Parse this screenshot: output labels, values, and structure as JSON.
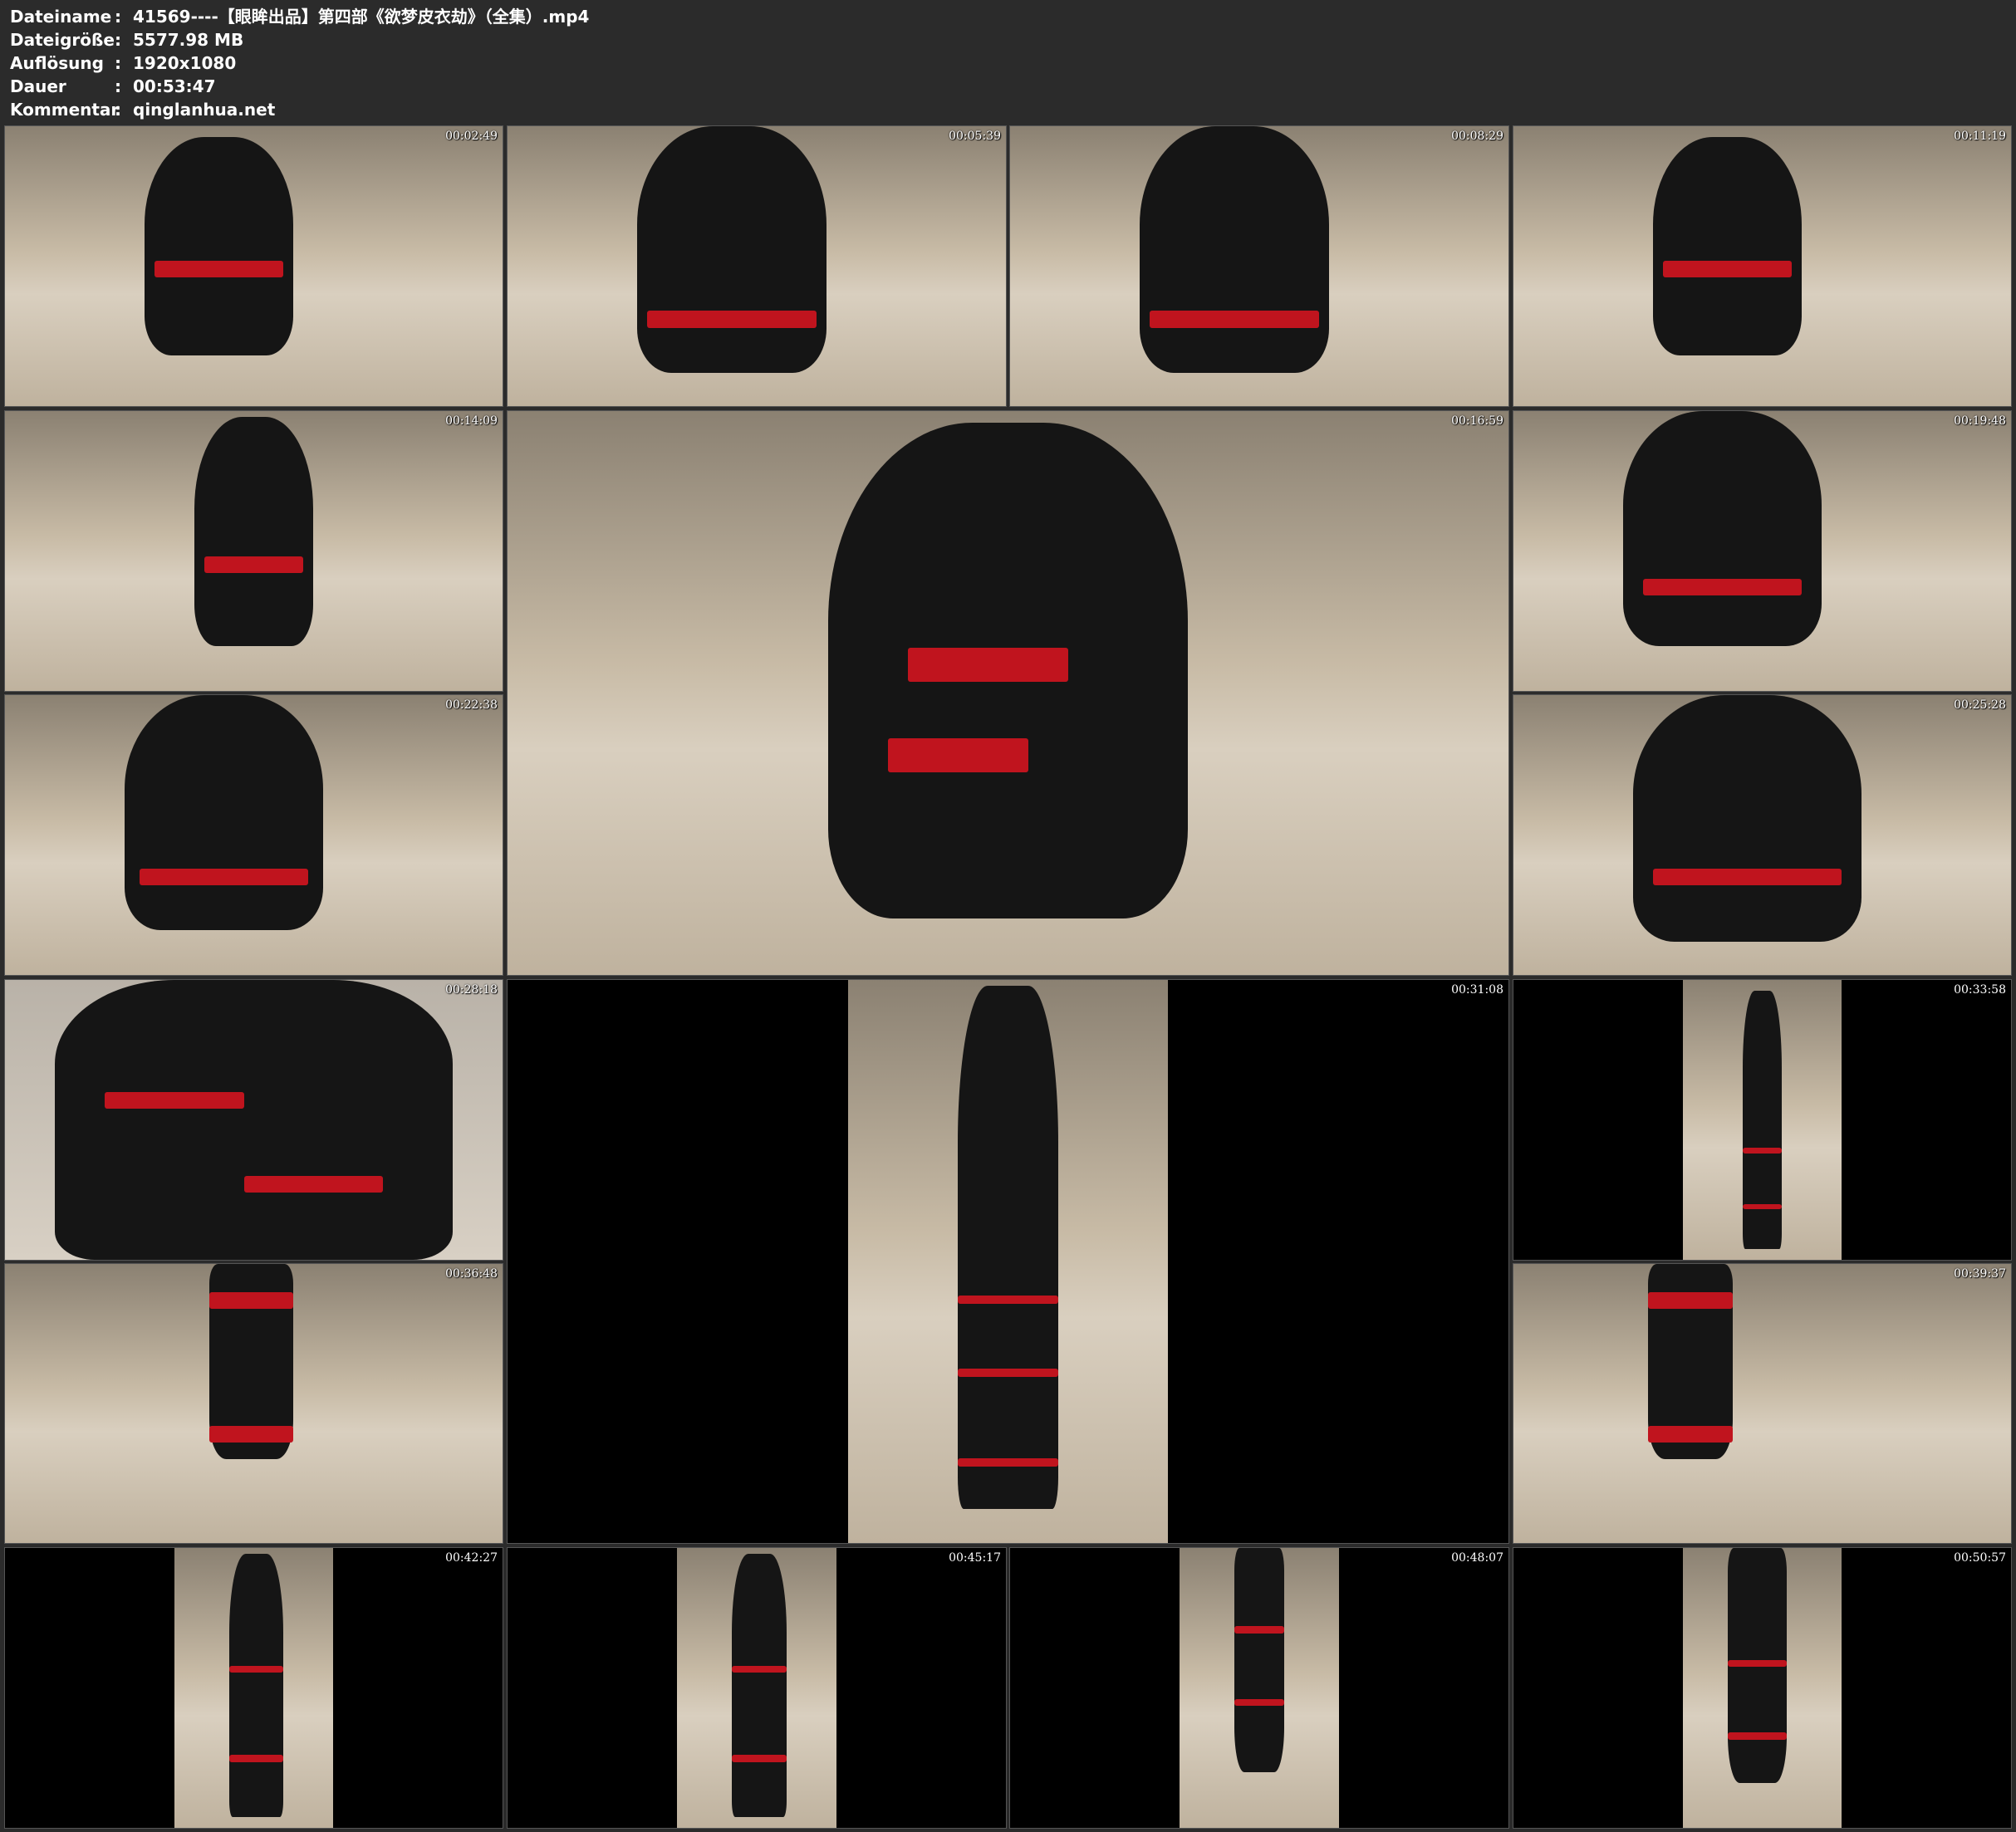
{
  "info": {
    "filename_label": "Dateiname",
    "filename": "41569----【眼眸出品】第四部《欲梦皮衣劫》（全集）.mp4",
    "filesize_label": "Dateigröße",
    "filesize": "5577.98 MB",
    "resolution_label": "Auflösung",
    "resolution": "1920x1080",
    "duration_label": "Dauer",
    "duration": "00:53:47",
    "comment_label": "Kommentar",
    "comment": "qinglanhua.net",
    "separator": ":"
  },
  "thumbnails": [
    {
      "time": "00:02:49"
    },
    {
      "time": "00:05:39"
    },
    {
      "time": "00:08:29"
    },
    {
      "time": "00:11:19"
    },
    {
      "time": "00:14:09"
    },
    {
      "time": "00:16:59"
    },
    {
      "time": "00:19:48"
    },
    {
      "time": "00:22:38"
    },
    {
      "time": "00:25:28"
    },
    {
      "time": "00:28:18"
    },
    {
      "time": "00:31:08"
    },
    {
      "time": "00:33:58"
    },
    {
      "time": "00:36:48"
    },
    {
      "time": "00:39:37"
    },
    {
      "time": "00:42:27"
    },
    {
      "time": "00:45:17"
    },
    {
      "time": "00:48:07"
    },
    {
      "time": "00:50:57"
    }
  ]
}
